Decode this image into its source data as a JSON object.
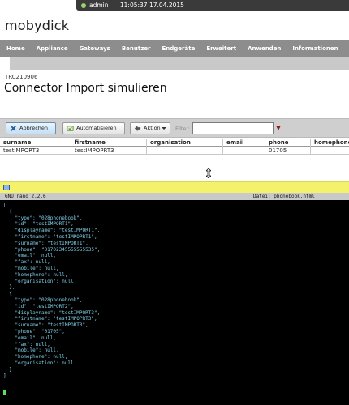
{
  "topbar": {
    "user": "admin",
    "datetime": "11:05:37 17.04.2015"
  },
  "brand": "mobydick",
  "nav": [
    "Home",
    "Appliance",
    "Gateways",
    "Benutzer",
    "Endgeräte",
    "Erweitert",
    "Anwenden",
    "Informationen"
  ],
  "page": {
    "code": "TRC210906",
    "title": "Connector Import simulieren"
  },
  "toolbar": {
    "cancel_label": "Abbrechen",
    "auto_label": "Automatisieren",
    "action_label": "Aktion",
    "filter_label": "Filter:",
    "filter_value": ""
  },
  "table": {
    "columns": [
      "surname",
      "firstname",
      "organisation",
      "email",
      "phone",
      "homephone"
    ],
    "rows": [
      [
        "testIMPORT3",
        "testIMPOPRT3",
        "",
        "",
        "01705",
        ""
      ]
    ]
  },
  "terminal": {
    "header_left": "GNU nano 2.2.6",
    "header_right": "Datei: phonebook.html",
    "lines": [
      "[",
      "  {",
      "    \"type\": \"028phonebook\",",
      "    \"id\": \"testIMPORT1\",",
      "    \"displayname\": \"testIMPORT1\",",
      "    \"firstname\": \"testIMPOPRT1\",",
      "    \"surname\": \"testIMPORT1\",",
      "    \"phone\": \"01702345555555535\",",
      "    \"email\": null,",
      "    \"fax\": null,",
      "    \"mobile\": null,",
      "    \"homephone\": null,",
      "    \"organisation\": null",
      "  },",
      "  {",
      "    \"type\": \"028phonebook\",",
      "    \"id\": \"testIMPORT2\",",
      "    \"displayname\": \"testIMPORT3\",",
      "    \"firstname\": \"testIMPOPRT3\",",
      "    \"surname\": \"testIMPORT3\",",
      "    \"phone\": \"01705\",",
      "    \"email\": null,",
      "    \"fax\": null,",
      "    \"mobile\": null,",
      "    \"homephone\": null,",
      "    \"organisation\": null",
      "  }",
      "]"
    ]
  }
}
